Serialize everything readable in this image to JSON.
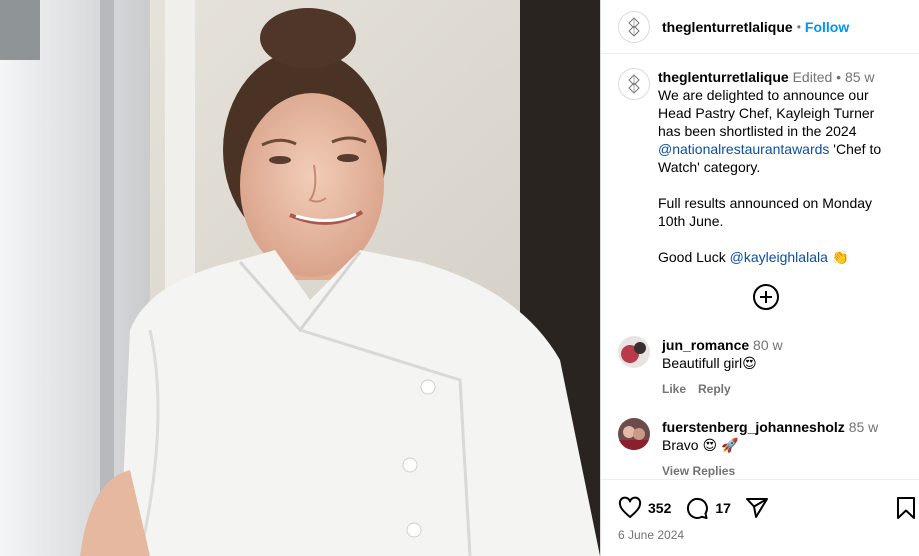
{
  "header": {
    "username": "theglenturretlalique",
    "separator": "•",
    "follow_label": "Follow"
  },
  "caption": {
    "username": "theglenturretlalique",
    "edited": "Edited",
    "dot": "•",
    "time": "85 w",
    "line1": "We are delighted to announce our Head Pastry Chef, Kayleigh Turner has been shortlisted in the 2024",
    "mention1": "@nationalrestaurantawards",
    "line1_end": " 'Chef to Watch' category.",
    "para2": "Full results announced on Monday 10th June.",
    "para3_prefix": "Good Luck ",
    "mention2": "@kayleighlalala",
    "emoji": "👏"
  },
  "comments": [
    {
      "username": "jun_romance",
      "time": "80 w",
      "text": "Beautifull girl😍",
      "like": "Like",
      "reply": "Reply"
    },
    {
      "username": "fuerstenberg_johannesholz",
      "time": "85 w",
      "text": "Bravo 😍 🚀",
      "like": "View Replies",
      "reply": ""
    }
  ],
  "footer": {
    "likes": "352",
    "comments": "17",
    "date": "6 June 2024"
  },
  "colors": {
    "accent": "#0095f6",
    "link": "#00376b",
    "muted": "#737373",
    "border": "#dbdbdb"
  },
  "icons": [
    "logo-icon",
    "add-comments-icon",
    "heart-icon",
    "comment-icon",
    "share-icon",
    "bookmark-icon"
  ]
}
